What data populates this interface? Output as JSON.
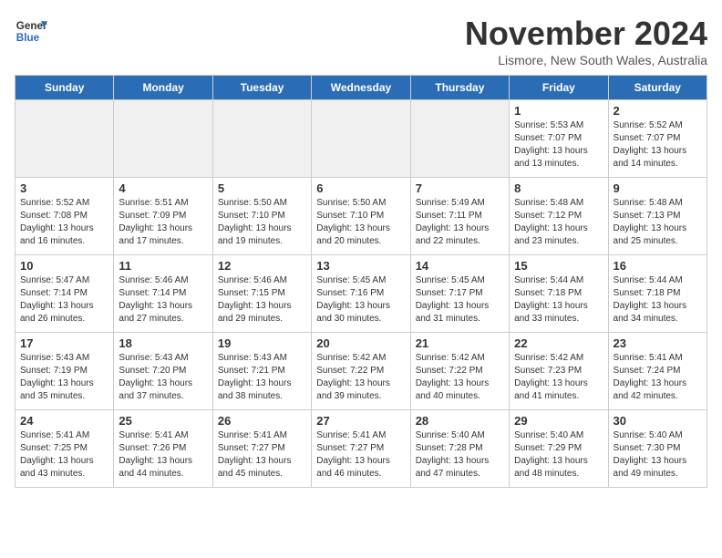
{
  "header": {
    "logo_line1": "General",
    "logo_line2": "Blue",
    "month": "November 2024",
    "location": "Lismore, New South Wales, Australia"
  },
  "weekdays": [
    "Sunday",
    "Monday",
    "Tuesday",
    "Wednesday",
    "Thursday",
    "Friday",
    "Saturday"
  ],
  "weeks": [
    [
      {
        "day": "",
        "detail": ""
      },
      {
        "day": "",
        "detail": ""
      },
      {
        "day": "",
        "detail": ""
      },
      {
        "day": "",
        "detail": ""
      },
      {
        "day": "",
        "detail": ""
      },
      {
        "day": "1",
        "detail": "Sunrise: 5:53 AM\nSunset: 7:07 PM\nDaylight: 13 hours\nand 13 minutes."
      },
      {
        "day": "2",
        "detail": "Sunrise: 5:52 AM\nSunset: 7:07 PM\nDaylight: 13 hours\nand 14 minutes."
      }
    ],
    [
      {
        "day": "3",
        "detail": "Sunrise: 5:52 AM\nSunset: 7:08 PM\nDaylight: 13 hours\nand 16 minutes."
      },
      {
        "day": "4",
        "detail": "Sunrise: 5:51 AM\nSunset: 7:09 PM\nDaylight: 13 hours\nand 17 minutes."
      },
      {
        "day": "5",
        "detail": "Sunrise: 5:50 AM\nSunset: 7:10 PM\nDaylight: 13 hours\nand 19 minutes."
      },
      {
        "day": "6",
        "detail": "Sunrise: 5:50 AM\nSunset: 7:10 PM\nDaylight: 13 hours\nand 20 minutes."
      },
      {
        "day": "7",
        "detail": "Sunrise: 5:49 AM\nSunset: 7:11 PM\nDaylight: 13 hours\nand 22 minutes."
      },
      {
        "day": "8",
        "detail": "Sunrise: 5:48 AM\nSunset: 7:12 PM\nDaylight: 13 hours\nand 23 minutes."
      },
      {
        "day": "9",
        "detail": "Sunrise: 5:48 AM\nSunset: 7:13 PM\nDaylight: 13 hours\nand 25 minutes."
      }
    ],
    [
      {
        "day": "10",
        "detail": "Sunrise: 5:47 AM\nSunset: 7:14 PM\nDaylight: 13 hours\nand 26 minutes."
      },
      {
        "day": "11",
        "detail": "Sunrise: 5:46 AM\nSunset: 7:14 PM\nDaylight: 13 hours\nand 27 minutes."
      },
      {
        "day": "12",
        "detail": "Sunrise: 5:46 AM\nSunset: 7:15 PM\nDaylight: 13 hours\nand 29 minutes."
      },
      {
        "day": "13",
        "detail": "Sunrise: 5:45 AM\nSunset: 7:16 PM\nDaylight: 13 hours\nand 30 minutes."
      },
      {
        "day": "14",
        "detail": "Sunrise: 5:45 AM\nSunset: 7:17 PM\nDaylight: 13 hours\nand 31 minutes."
      },
      {
        "day": "15",
        "detail": "Sunrise: 5:44 AM\nSunset: 7:18 PM\nDaylight: 13 hours\nand 33 minutes."
      },
      {
        "day": "16",
        "detail": "Sunrise: 5:44 AM\nSunset: 7:18 PM\nDaylight: 13 hours\nand 34 minutes."
      }
    ],
    [
      {
        "day": "17",
        "detail": "Sunrise: 5:43 AM\nSunset: 7:19 PM\nDaylight: 13 hours\nand 35 minutes."
      },
      {
        "day": "18",
        "detail": "Sunrise: 5:43 AM\nSunset: 7:20 PM\nDaylight: 13 hours\nand 37 minutes."
      },
      {
        "day": "19",
        "detail": "Sunrise: 5:43 AM\nSunset: 7:21 PM\nDaylight: 13 hours\nand 38 minutes."
      },
      {
        "day": "20",
        "detail": "Sunrise: 5:42 AM\nSunset: 7:22 PM\nDaylight: 13 hours\nand 39 minutes."
      },
      {
        "day": "21",
        "detail": "Sunrise: 5:42 AM\nSunset: 7:22 PM\nDaylight: 13 hours\nand 40 minutes."
      },
      {
        "day": "22",
        "detail": "Sunrise: 5:42 AM\nSunset: 7:23 PM\nDaylight: 13 hours\nand 41 minutes."
      },
      {
        "day": "23",
        "detail": "Sunrise: 5:41 AM\nSunset: 7:24 PM\nDaylight: 13 hours\nand 42 minutes."
      }
    ],
    [
      {
        "day": "24",
        "detail": "Sunrise: 5:41 AM\nSunset: 7:25 PM\nDaylight: 13 hours\nand 43 minutes."
      },
      {
        "day": "25",
        "detail": "Sunrise: 5:41 AM\nSunset: 7:26 PM\nDaylight: 13 hours\nand 44 minutes."
      },
      {
        "day": "26",
        "detail": "Sunrise: 5:41 AM\nSunset: 7:27 PM\nDaylight: 13 hours\nand 45 minutes."
      },
      {
        "day": "27",
        "detail": "Sunrise: 5:41 AM\nSunset: 7:27 PM\nDaylight: 13 hours\nand 46 minutes."
      },
      {
        "day": "28",
        "detail": "Sunrise: 5:40 AM\nSunset: 7:28 PM\nDaylight: 13 hours\nand 47 minutes."
      },
      {
        "day": "29",
        "detail": "Sunrise: 5:40 AM\nSunset: 7:29 PM\nDaylight: 13 hours\nand 48 minutes."
      },
      {
        "day": "30",
        "detail": "Sunrise: 5:40 AM\nSunset: 7:30 PM\nDaylight: 13 hours\nand 49 minutes."
      }
    ]
  ]
}
